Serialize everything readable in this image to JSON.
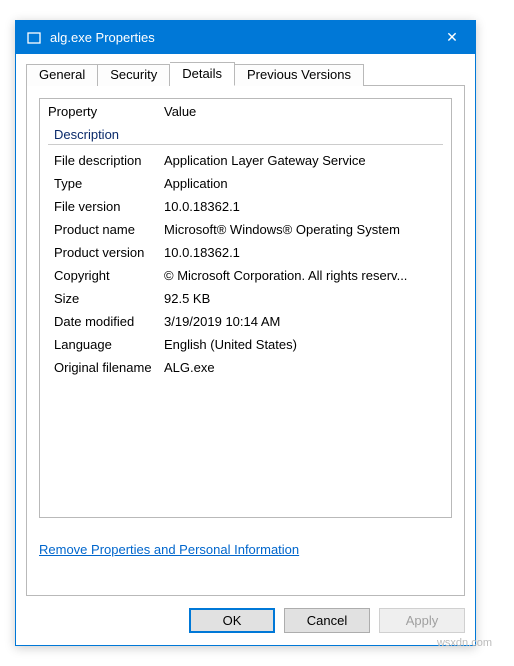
{
  "window": {
    "title": "alg.exe Properties",
    "close_icon_glyph": "✕"
  },
  "tabs": {
    "general": "General",
    "security": "Security",
    "details": "Details",
    "previous": "Previous Versions"
  },
  "columns": {
    "property": "Property",
    "value": "Value"
  },
  "group_label": "Description",
  "props": {
    "file_description": {
      "label": "File description",
      "value": "Application Layer Gateway Service"
    },
    "type": {
      "label": "Type",
      "value": "Application"
    },
    "file_version": {
      "label": "File version",
      "value": "10.0.18362.1"
    },
    "product_name": {
      "label": "Product name",
      "value": "Microsoft® Windows® Operating System"
    },
    "product_version": {
      "label": "Product version",
      "value": "10.0.18362.1"
    },
    "copyright": {
      "label": "Copyright",
      "value": "© Microsoft Corporation. All rights reserv..."
    },
    "size": {
      "label": "Size",
      "value": "92.5 KB"
    },
    "date_modified": {
      "label": "Date modified",
      "value": "3/19/2019 10:14 AM"
    },
    "language": {
      "label": "Language",
      "value": "English (United States)"
    },
    "original_fn": {
      "label": "Original filename",
      "value": "ALG.exe"
    }
  },
  "link_text": "Remove Properties and Personal Information",
  "buttons": {
    "ok": "OK",
    "cancel": "Cancel",
    "apply": "Apply"
  },
  "watermark": "wsxdn.com"
}
